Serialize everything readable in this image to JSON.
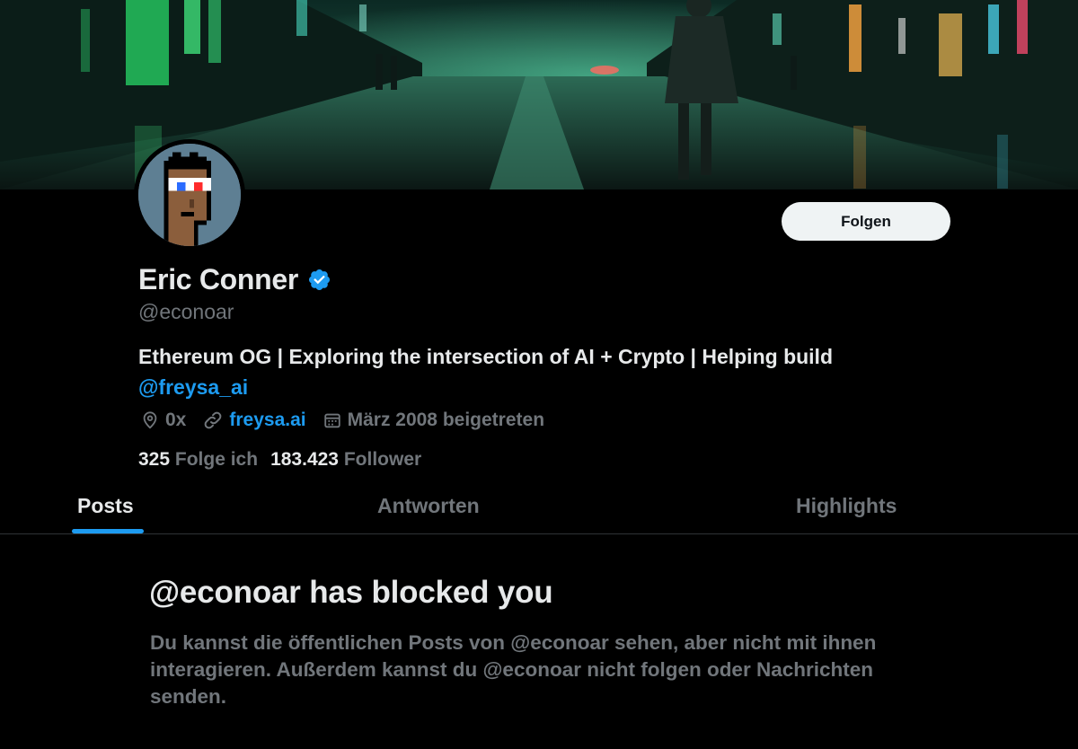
{
  "profile": {
    "display_name": "Eric Conner",
    "handle": "@econoar",
    "bio_text": "Ethereum OG | Exploring the intersection of AI + Crypto | Helping build",
    "bio_mention": "@freysa_ai",
    "location": "0x",
    "website": "freysa.ai",
    "joined": "März 2008 beigetreten",
    "following_count": "325",
    "following_label": "Folge ich",
    "followers_count": "183.423",
    "followers_label": "Follower"
  },
  "actions": {
    "follow_label": "Folgen"
  },
  "tabs": [
    {
      "label": "Posts",
      "active": true
    },
    {
      "label": "Antworten",
      "active": false
    },
    {
      "label": "Highlights",
      "active": false
    }
  ],
  "blocked": {
    "title": "@econoar has blocked you",
    "body": "Du kannst die öffentlichen Posts von @econoar sehen, aber nicht mit ihnen interagieren. Außerdem kannst du @econoar nicht folgen oder Nachrichten senden."
  },
  "icons": {
    "verified": "verified-badge-icon",
    "location": "location-pin-icon",
    "link": "link-icon",
    "calendar": "calendar-icon"
  },
  "colors": {
    "accent": "#1d9bf0",
    "text_primary": "#e7e9ea",
    "text_secondary": "#71767b",
    "background": "#000000",
    "button_bg": "#eff3f4"
  }
}
